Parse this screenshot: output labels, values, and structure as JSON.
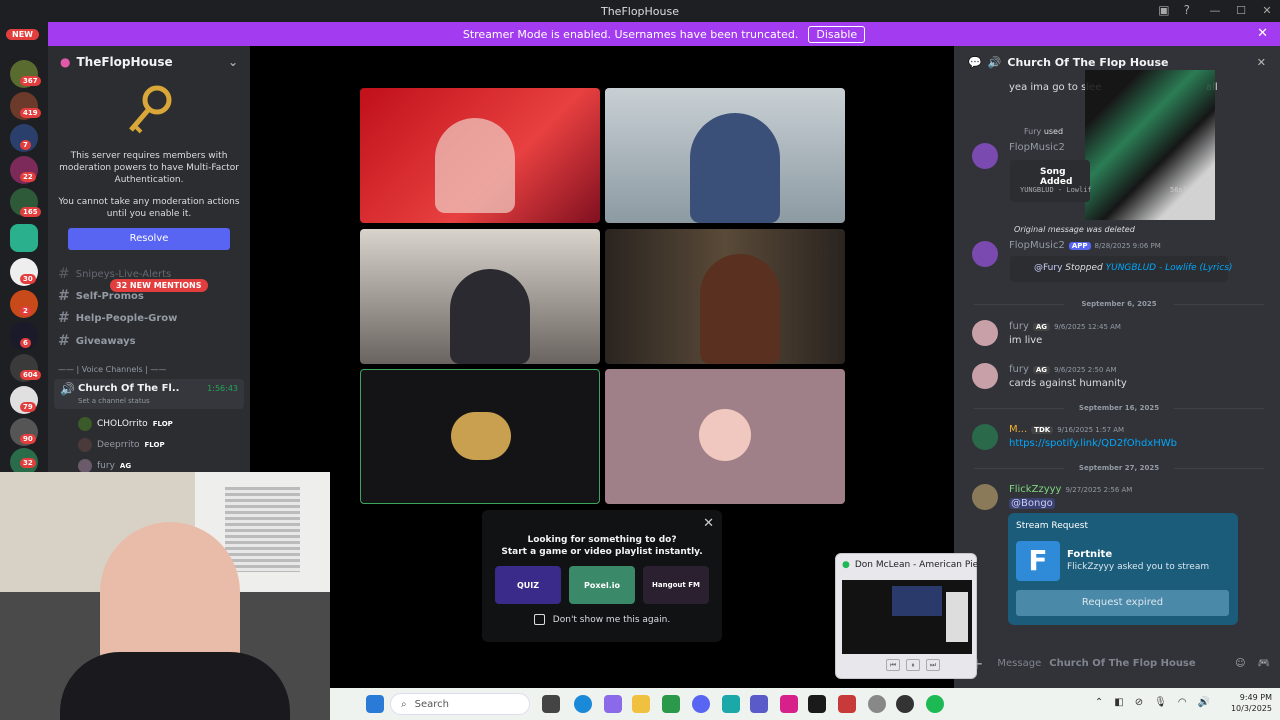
{
  "window": {
    "title": "TheFlopHouse"
  },
  "banner": {
    "text": "Streamer Mode is enabled. Usernames have been truncated.",
    "disable_label": "Disable"
  },
  "server_rail": {
    "new_label": "NEW",
    "badges": [
      "367",
      "419",
      "7",
      "22",
      "165",
      "30",
      "2",
      "6",
      "604",
      "79",
      "90",
      "32"
    ]
  },
  "sidebar": {
    "guild_name": "TheFlopHouse",
    "mfa_text_1": "This server requires members with moderation powers to have Multi-Factor Authentication.",
    "mfa_text_2": "You cannot take any moderation actions until you enable it.",
    "resolve_label": "Resolve",
    "mentions_pill": "32 NEW MENTIONS",
    "channels": [
      "Snipeys-Live-Alerts",
      "Self-Promos",
      "Help-People-Grow",
      "Giveaways"
    ],
    "voice_category": "—— | Voice Channels | ——",
    "voice_channel": {
      "name": "Church Of The Fl..",
      "timer": "1:56:43",
      "status": "Set a channel status"
    },
    "voice_members": [
      {
        "name": "CHOLOrrito",
        "tag": "FLOP"
      },
      {
        "name": "Deeprrito",
        "tag": "FLOP"
      },
      {
        "name": "fury",
        "tag": "AG"
      }
    ]
  },
  "activity_popup": {
    "line1": "Looking for something to do?",
    "line2": "Start a game or video playlist instantly.",
    "games": [
      "QUIZ",
      "Poxel.io",
      "Hangout FM"
    ],
    "checkbox_label": "Don't show me this again."
  },
  "chat": {
    "channel_name": "Church Of The Flop House",
    "first_line": "yea ima go to slee",
    "first_line_tail": "all",
    "reply_user": "Fury",
    "reply_used": "used",
    "bot1": {
      "name": "FlopMusic2",
      "embed_title": "Song Added",
      "embed_code": "YUNGBLUD - Lowlif",
      "embed_code_tail": "56s]"
    },
    "deleted_note": "Original message was deleted",
    "bot2": {
      "name": "FlopMusic2",
      "app_tag": "APP",
      "time": "8/28/2025 9:06 PM",
      "mention": "@Fury",
      "stopped": "Stopped",
      "track": "YUNGBLUD - Lowlife (Lyrics)"
    },
    "dividers": [
      "September 6, 2025",
      "September 16, 2025",
      "September 27, 2025"
    ],
    "messages": [
      {
        "user": "fury",
        "tag": "AG",
        "time": "9/6/2025 12:45 AM",
        "text": "im live"
      },
      {
        "user": "fury",
        "tag": "AG",
        "time": "9/6/2025 2:50 AM",
        "text": "cards against humanity"
      },
      {
        "user": "M...",
        "tag": "TDK",
        "time": "9/16/2025 1:57 AM",
        "text": "https://spotify.link/QD2fOhdxHWb"
      },
      {
        "user": "FlickZzyyy",
        "tag": "",
        "time": "9/27/2025 2:56 AM",
        "text": "@Bongo"
      }
    ],
    "stream_request": {
      "title": "Stream Request",
      "game": "Fortnite",
      "ask": "FlickZzyyy asked you to stream",
      "expired_label": "Request expired"
    },
    "composer_placeholder": "Message",
    "composer_channel": "Church Of The Flop House"
  },
  "spotify_preview": {
    "title": "Don McLean - American Pie"
  },
  "taskbar": {
    "search_placeholder": "Search",
    "time": "9:49 PM",
    "date": "10/3/2025"
  },
  "colors": {
    "accent": "#5865f2",
    "banner": "#a33cf0",
    "stream_card": "#1b5c7a"
  }
}
